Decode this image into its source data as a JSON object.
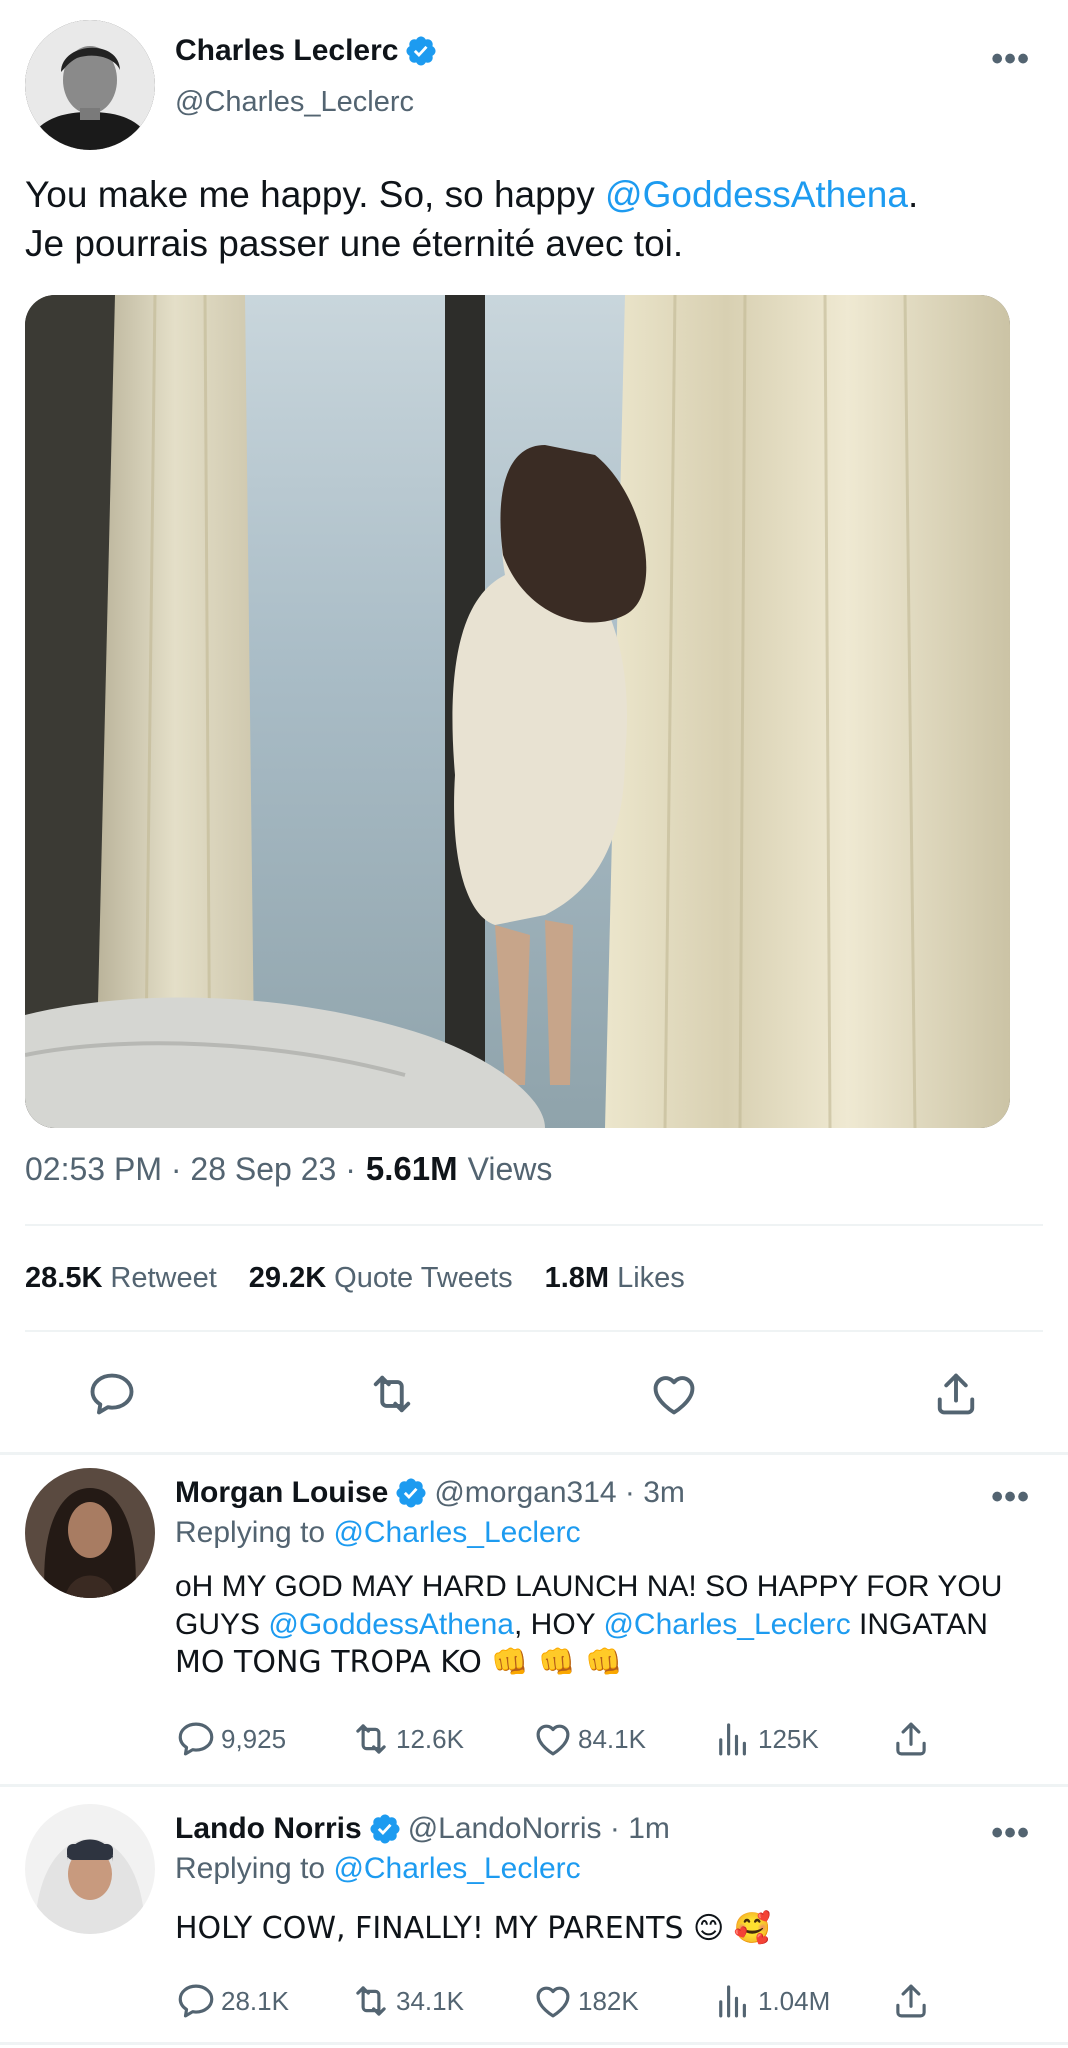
{
  "tweet": {
    "author_name": "Charles Leclerc",
    "author_handle": "@Charles_Leclerc",
    "text_part1": "You make me happy. So, so happy ",
    "mention": "@GoddessAthena",
    "text_part2": ".",
    "text_line2": "Je pourrais passer une éternité avec toi.",
    "time": "02:53 PM · 28 Sep 23 ·",
    "views_count": "5.61M",
    "views_label": "Views",
    "retweets_count": "28.5K",
    "retweets_label": "Retweet",
    "quotes_count": "29.2K",
    "quotes_label": "Quote Tweets",
    "likes_count": "1.8M",
    "likes_label": "Likes",
    "more_label": "•••"
  },
  "replies": [
    {
      "name": "Morgan Louise",
      "handle": "@morgan314 · 3m",
      "replying_prefix": "Replying to",
      "replying_to": "@Charles_Leclerc",
      "line1": "oH MY GOD MAY HARD LAUNCH NA! SO HAPPY FOR YOU",
      "line2_a": "GUYS ",
      "line2_mention1": "@GoddessAthena",
      "line2_b": ", HOY ",
      "line2_mention2": "@Charles_Leclerc",
      "line2_c": " INGATAN",
      "line3": "MO TONG TROPA KO 👊 👊 👊",
      "comments": "9,925",
      "retweets": "12.6K",
      "likes": "84.1K",
      "views": "125K",
      "more_label": "•••"
    },
    {
      "name": "Lando Norris",
      "handle": "@LandoNorris · 1m",
      "replying_prefix": "Replying to",
      "replying_to": "@Charles_Leclerc",
      "line1": "HOLY COW, FINALLY! MY PARENTS 😊 🥰",
      "comments": "28.1K",
      "retweets": "34.1K",
      "likes": "182K",
      "views": "1.04M",
      "more_label": "•••"
    }
  ],
  "icons": [
    "verified-badge-icon",
    "more-icon",
    "reply-icon",
    "retweet-icon",
    "like-icon",
    "share-icon",
    "views-icon"
  ],
  "colors": {
    "accent": "#1d9bf0",
    "muted": "#536471",
    "text": "#0f1419",
    "divider": "#eff3f4"
  }
}
